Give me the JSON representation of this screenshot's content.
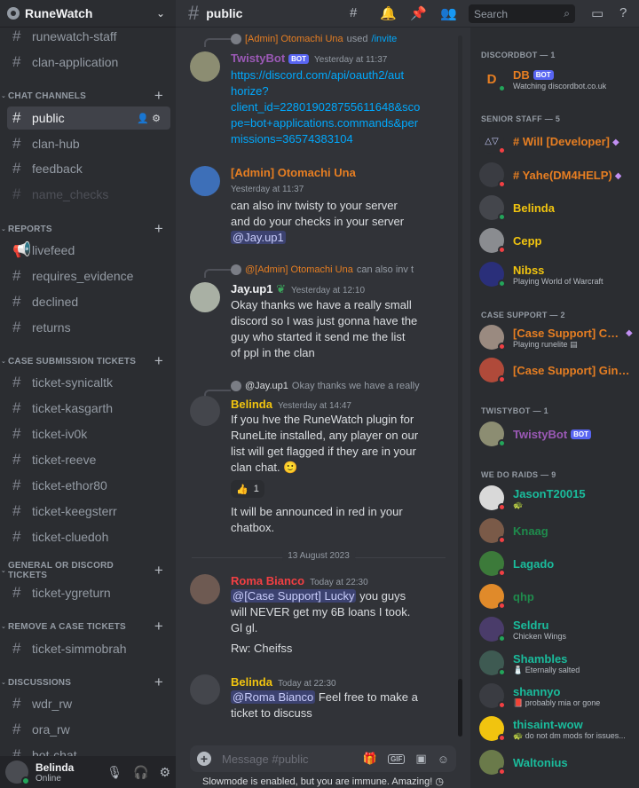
{
  "server": {
    "name": "RuneWatch"
  },
  "sidebar": {
    "channels_top": [
      {
        "name": "runewatch-staff"
      },
      {
        "name": "clan-application"
      }
    ],
    "categories": [
      {
        "name": "CHAT CHANNELS",
        "channels": [
          {
            "name": "public",
            "selected": true
          },
          {
            "name": "clan-hub"
          },
          {
            "name": "feedback"
          },
          {
            "name": "name_checks",
            "muted": true
          }
        ]
      },
      {
        "name": "REPORTS",
        "channels": [
          {
            "name": "livefeed"
          },
          {
            "name": "requires_evidence"
          },
          {
            "name": "declined"
          },
          {
            "name": "returns"
          }
        ]
      },
      {
        "name": "CASE SUBMISSION TICKETS",
        "channels": [
          {
            "name": "ticket-synicaltk"
          },
          {
            "name": "ticket-kasgarth"
          },
          {
            "name": "ticket-iv0k"
          },
          {
            "name": "ticket-reeve"
          },
          {
            "name": "ticket-ethor80"
          },
          {
            "name": "ticket-keegsterr"
          },
          {
            "name": "ticket-cluedoh"
          }
        ]
      },
      {
        "name": "GENERAL OR DISCORD TICKETS",
        "channels": [
          {
            "name": "ticket-ygreturn"
          }
        ]
      },
      {
        "name": "REMOVE A CASE TICKETS",
        "channels": [
          {
            "name": "ticket-simmobrah"
          }
        ]
      },
      {
        "name": "DISCUSSIONS",
        "channels": [
          {
            "name": "wdr_rw"
          },
          {
            "name": "ora_rw"
          },
          {
            "name": "bot-chat"
          }
        ]
      }
    ]
  },
  "user": {
    "name": "Belinda",
    "status": "Online"
  },
  "topbar": {
    "channel": "public",
    "search_placeholder": "Search"
  },
  "messages": [
    {
      "reply_author": "[Admin] Otomachi Una",
      "reply_text": "used",
      "reply_cmd": "/invite",
      "author": "TwistyBot",
      "bot": "BOT",
      "time": "Yesterday at 11:37",
      "lines": [
        "https://discord.com/api/oauth2/aut",
        "horize?",
        "client_id=228019028755611648&sco",
        "pe=bot+applications.commands&per",
        "missions=36574383104"
      ]
    },
    {
      "author": "[Admin] Otomachi Una",
      "time": "Yesterday at 11:37",
      "lines": [
        "can also inv twisty to your server",
        "and do your checks in your server"
      ],
      "mention": "@Jay.up1"
    },
    {
      "reply_author": "@[Admin] Otomachi Una",
      "reply_text": "can also inv t",
      "author": "Jay.up1",
      "time": "Yesterday at 12:10",
      "lines": [
        "Okay thanks we have a really small",
        "discord so I was just gonna have the",
        "guy who started it send me the list",
        "of ppl in the clan"
      ]
    },
    {
      "reply_author": "@Jay.up1",
      "reply_text": "Okay thanks we have a really",
      "author": "Belinda",
      "time": "Yesterday at 14:47",
      "lines": [
        "If you hve the RuneWatch plugin for",
        "RuneLite installed, any player on our",
        "list will get flagged if they are in your",
        "clan chat."
      ],
      "reaction": {
        "emoji": "👍",
        "count": "1"
      },
      "lines2": [
        "It will be announced in red in your",
        "chatbox."
      ]
    },
    {
      "author": "Roma Bianco",
      "time": "Today at 22:30",
      "mention": "@[Case Support] Lucky",
      "lines": [
        " you guys",
        "will NEVER get my 6B loans I took.",
        "Gl gl."
      ],
      "lines2": [
        "Rw: Cheifss"
      ]
    },
    {
      "author": "Belinda",
      "time": "Today at 22:30",
      "mention": "@Roma Bianco",
      "lines": [
        " Feel free to make a",
        "ticket to discuss"
      ]
    }
  ],
  "date_separator": "13 August 2023",
  "composer": {
    "placeholder": "Message #public",
    "gif": "GIF"
  },
  "slowmode": "Slowmode is enabled, but you are immune. Amazing!",
  "members": {
    "groups": [
      {
        "name": "DISCORDBOT — 1",
        "members": [
          {
            "name": "DB",
            "bot": "BOT",
            "sub": "Watching discordbot.co.uk",
            "color": "#e67e22",
            "status": "online"
          }
        ]
      },
      {
        "name": "SENIOR STAFF — 5",
        "members": [
          {
            "name": "# Will [Developer]",
            "color": "#e67e22",
            "status": "dnd"
          },
          {
            "name": "# Yahe(DM4HELP)",
            "color": "#e67e22",
            "status": "dnd"
          },
          {
            "name": "Belinda",
            "color": "#f1c40f",
            "status": "online"
          },
          {
            "name": "Cepp",
            "color": "#f1c40f",
            "status": "dnd"
          },
          {
            "name": "Nibss",
            "sub": "Playing World of Warcraft",
            "color": "#f1c40f",
            "status": "online"
          }
        ]
      },
      {
        "name": "CASE SUPPORT — 2",
        "members": [
          {
            "name": "[Case Support] Con...",
            "sub": "Playing runelite",
            "color": "#e67e22",
            "status": "dnd"
          },
          {
            "name": "[Case Support] Ginge...",
            "color": "#e67e22",
            "status": "dnd"
          }
        ]
      },
      {
        "name": "TWISTYBOT — 1",
        "members": [
          {
            "name": "TwistyBot",
            "bot": "BOT",
            "color": "#9b59b6",
            "status": "online"
          }
        ]
      },
      {
        "name": "WE DO RAIDS — 9",
        "members": [
          {
            "name": "JasonT20015",
            "sub": "🐢",
            "color": "#1abc9c",
            "status": "dnd"
          },
          {
            "name": "Knaag",
            "color": "#1f8b4c",
            "status": "dnd"
          },
          {
            "name": "Lagado",
            "color": "#1abc9c",
            "status": "dnd"
          },
          {
            "name": "qhp",
            "color": "#1f8b4c",
            "status": "dnd"
          },
          {
            "name": "Seldru",
            "sub": "Chicken Wings",
            "color": "#1abc9c",
            "status": "online"
          },
          {
            "name": "Shambles",
            "sub": "Eternally salted",
            "color": "#1abc9c",
            "status": "online"
          },
          {
            "name": "shannyo",
            "sub": "probably mia or gone",
            "color": "#1abc9c",
            "status": "dnd"
          },
          {
            "name": "thisaint-wow",
            "sub": "do not dm mods for issues...",
            "color": "#1abc9c",
            "status": "dnd"
          },
          {
            "name": "Waltonius",
            "color": "#1abc9c",
            "status": "dnd"
          }
        ]
      }
    ]
  },
  "colors": {
    "accent": "#5865f2",
    "online": "#23a55a",
    "dnd": "#f23f43",
    "link": "#00a8fc"
  }
}
